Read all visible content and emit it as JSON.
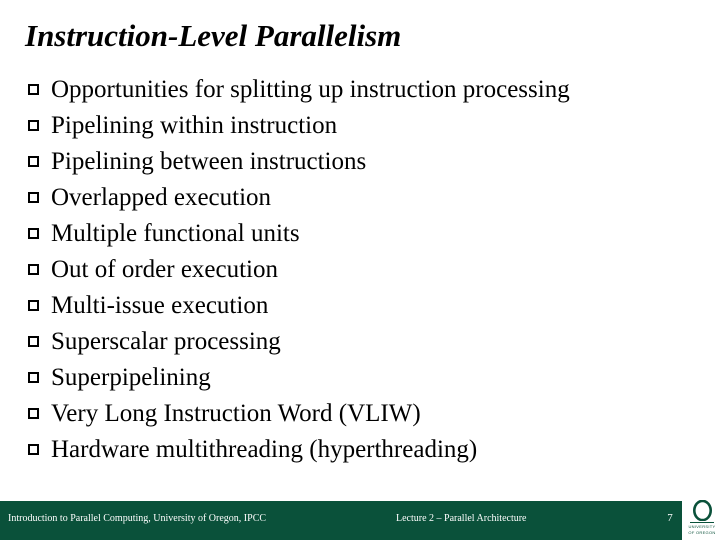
{
  "slide": {
    "title": "Instruction-Level Parallelism",
    "bullet_marker": "hollow-square",
    "bullets": [
      {
        "text": "Opportunities for splitting up instruction processing"
      },
      {
        "text": "Pipelining within instruction"
      },
      {
        "text": "Pipelining between instructions"
      },
      {
        "text": "Overlapped execution"
      },
      {
        "text": "Multiple functional units"
      },
      {
        "text": "Out of order execution"
      },
      {
        "text": "Multi-issue execution"
      },
      {
        "text": "Superscalar processing"
      },
      {
        "text": "Superpipelining"
      },
      {
        "text": "Very Long Instruction Word (VLIW)"
      },
      {
        "text": "Hardware multithreading (hyperthreading)"
      }
    ]
  },
  "footer": {
    "left": "Introduction to Parallel Computing, University of Oregon, IPCC",
    "center": "Lecture 2 – Parallel Architecture",
    "page_number": "7",
    "bar_color": "#0a513a"
  },
  "logo": {
    "mark": "O",
    "line1": "UNIVERSITY",
    "line2": "OF OREGON",
    "color": "#0a513a"
  }
}
